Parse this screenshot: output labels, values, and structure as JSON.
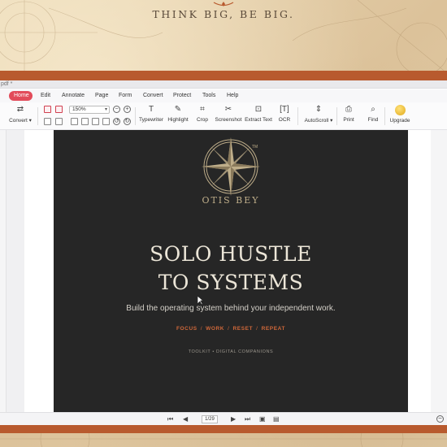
{
  "banner": {
    "tagline": "THINK BIG, BE BIG."
  },
  "window": {
    "title_fragment": "pdf *",
    "menu": [
      "Home",
      "Edit",
      "Annotate",
      "Page",
      "Form",
      "Convert",
      "Protect",
      "Tools",
      "Help"
    ],
    "active_menu": "Home",
    "toolbar": {
      "convert_label": "Convert",
      "zoom_value": "150%",
      "tools": {
        "typewriter": "Typewriter",
        "highlight": "Highlight",
        "crop": "Crop",
        "screenshot": "Screenshot",
        "extract_text": "Extract Text",
        "ocr": "OCR",
        "autoscroll": "AutoScroll",
        "print": "Print",
        "find": "Find",
        "upgrade": "Upgrade"
      }
    },
    "status": {
      "page_display": "1/29"
    }
  },
  "document": {
    "brand": "OTIS BEY",
    "trademark": "TM",
    "headline_line1": "SOLO HUSTLE",
    "headline_line2": "TO SYSTEMS",
    "subline": "Build the operating system behind your independent work.",
    "pillars": [
      "FOCUS",
      "WORK",
      "RESET",
      "REPEAT"
    ],
    "pillar_separator": "/",
    "footer_note": "TOOLKIT • DIGITAL COMPANIONS"
  },
  "colors": {
    "accent_band": "#b85a2e",
    "active_tab": "#e24b5a",
    "doc_background": "#262626",
    "pillar_orange": "#d0683a",
    "compass_gold": "#bfae8a"
  }
}
